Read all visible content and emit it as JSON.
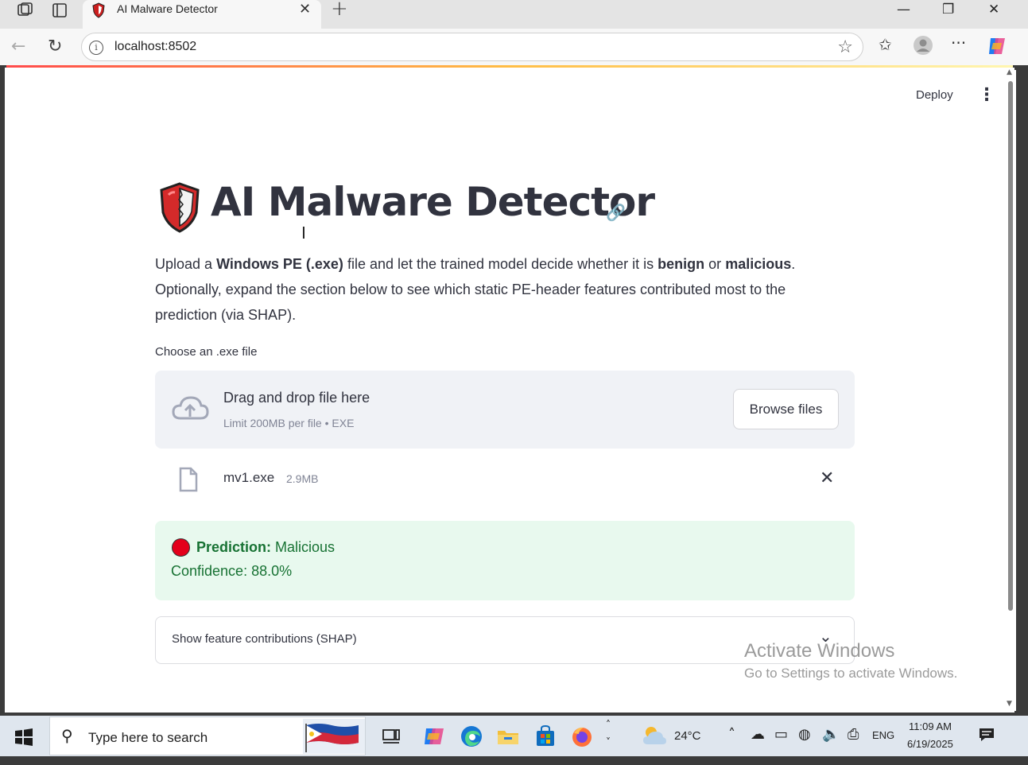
{
  "browser": {
    "tab_title": "AI Malware Detector",
    "tab_close": "✕",
    "new_tab": "+",
    "url": "localhost:8502",
    "minimize": "—",
    "restore": "❐",
    "close": "✕"
  },
  "app": {
    "deploy_label": "Deploy",
    "menu_glyph": "⋮",
    "title": "AI Malware Detector",
    "anchor_glyph": "🔗",
    "description": {
      "p1": "Upload a ",
      "b1": "Windows PE (.exe)",
      "p2": " file and let the trained model decide whether it is ",
      "b2": "benign",
      "p3": " or ",
      "b3": "malicious",
      "p4": ". Optionally, expand the section below to see which static PE-header features contributed most to the prediction (via SHAP)."
    },
    "uploader": {
      "label": "Choose an .exe file",
      "drag_text": "Drag and drop file here",
      "limit_text": "Limit 200MB per file • EXE",
      "browse_label": "Browse files"
    },
    "uploaded_file": {
      "name": "mv1.exe",
      "size": "2.9MB",
      "remove_glyph": "✕"
    },
    "result": {
      "prediction_label": "Prediction:",
      "prediction_value": " Malicious",
      "confidence_label": "Confidence:",
      "confidence_value": " 88.0%"
    },
    "expander": {
      "label": "Show feature contributions (SHAP)",
      "chevron": "⌄"
    }
  },
  "watermark": {
    "title": "Activate Windows",
    "subtitle": "Go to Settings to activate Windows."
  },
  "taskbar": {
    "search_placeholder": "Type here to search",
    "weather_temp": "24°C",
    "language": "ENG",
    "time": "11:09 AM",
    "date": "6/19/2025"
  },
  "colors": {
    "accent_red": "#ff4b4b",
    "success_bg": "#e8f9ee",
    "success_text": "#177233",
    "text": "#31333f"
  }
}
